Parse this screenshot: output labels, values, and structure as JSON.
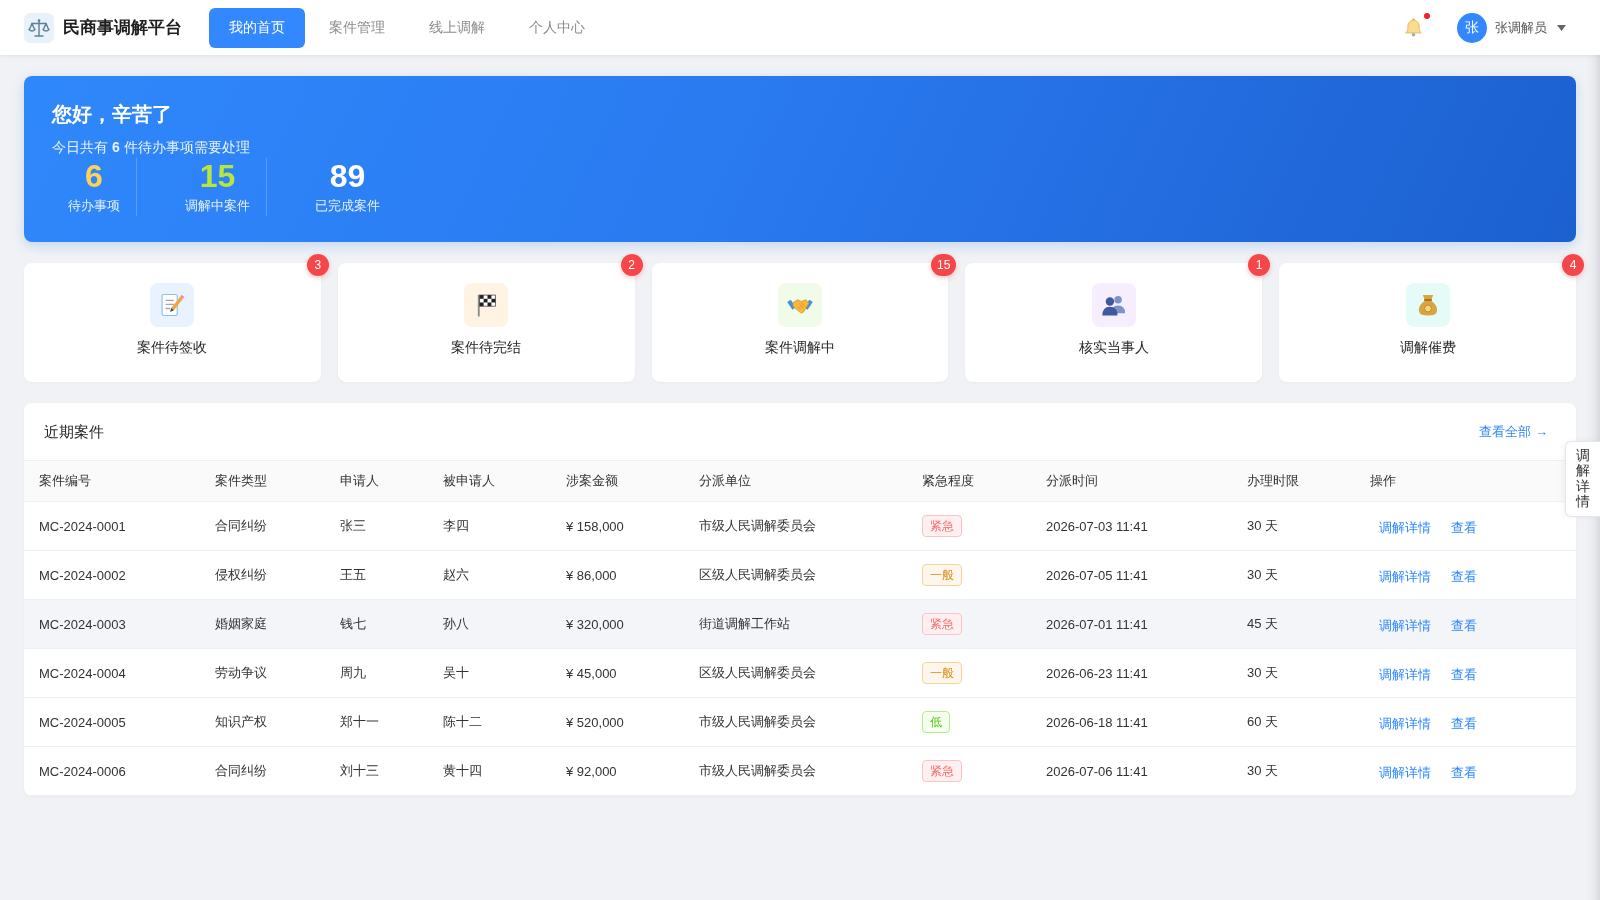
{
  "header": {
    "title": "民商事调解平台",
    "nav": [
      {
        "label": "我的首页",
        "selected": true
      },
      {
        "label": "案件管理",
        "selected": false
      },
      {
        "label": "线上调解",
        "selected": false
      },
      {
        "label": "个人中心",
        "selected": false
      }
    ],
    "notifications": {
      "unread": true
    },
    "user": {
      "avatar": "张",
      "name": "张调解员"
    }
  },
  "banner": {
    "greeting": "您好，辛苦了",
    "summary": "今日共有 **6** 件待办事项需要处理",
    "stats": [
      {
        "value": "6",
        "label": "待办事项",
        "color": "#fbd25a"
      },
      {
        "value": "15",
        "label": "调解中案件",
        "color": "#b9e63a"
      },
      {
        "value": "89",
        "label": "已完成案件",
        "color": "#ffffff"
      }
    ]
  },
  "shortcuts": [
    {
      "label": "案件待签收",
      "count": "3",
      "color": "#e8f3ff"
    },
    {
      "label": "案件待完结",
      "count": "2",
      "color": "#fff4e3"
    },
    {
      "label": "案件调解中",
      "count": "15",
      "color": "#f1fbe9"
    },
    {
      "label": "核实当事人",
      "count": "1",
      "color": "#f6edff"
    },
    {
      "label": "调解催费",
      "count": "4",
      "color": "#e5fbf8"
    }
  ],
  "recent_cases": {
    "title": "近期案件",
    "view_all": "查看全部 →",
    "columns": [
      "案件编号",
      "案件类型",
      "申请人",
      "被申请人",
      "涉案金额",
      "分派单位",
      "紧急程度",
      "分派时间",
      "办理时限",
      "操作"
    ],
    "rows": [
      {
        "case_no": "MC-2024-0001",
        "case_type": "合同纠纷",
        "applicant": "张三",
        "respondent": "李四",
        "amount": "¥ 158,000",
        "assigned_unit": "市级人民调解委员会",
        "urgency": {
          "text": "紧急",
          "kind": "high"
        },
        "assigned_at": "2026-07-03 11:41",
        "time_limit": "30 天",
        "actions": [
          "调解详情",
          "查看"
        ],
        "highlighted": false
      },
      {
        "case_no": "MC-2024-0002",
        "case_type": "侵权纠纷",
        "applicant": "王五",
        "respondent": "赵六",
        "amount": "¥ 86,000",
        "assigned_unit": "区级人民调解委员会",
        "urgency": {
          "text": "一般",
          "kind": "medium"
        },
        "assigned_at": "2026-07-05 11:41",
        "time_limit": "30 天",
        "actions": [
          "调解详情",
          "查看"
        ],
        "highlighted": false
      },
      {
        "case_no": "MC-2024-0003",
        "case_type": "婚姻家庭",
        "applicant": "钱七",
        "respondent": "孙八",
        "amount": "¥ 320,000",
        "assigned_unit": "街道调解工作站",
        "urgency": {
          "text": "紧急",
          "kind": "high"
        },
        "assigned_at": "2026-07-01 11:41",
        "time_limit": "45 天",
        "actions": [
          "调解详情",
          "查看"
        ],
        "highlighted": true
      },
      {
        "case_no": "MC-2024-0004",
        "case_type": "劳动争议",
        "applicant": "周九",
        "respondent": "吴十",
        "amount": "¥ 45,000",
        "assigned_unit": "区级人民调解委员会",
        "urgency": {
          "text": "一般",
          "kind": "medium"
        },
        "assigned_at": "2026-06-23 11:41",
        "time_limit": "30 天",
        "actions": [
          "调解详情",
          "查看"
        ],
        "highlighted": false
      },
      {
        "case_no": "MC-2024-0005",
        "case_type": "知识产权",
        "applicant": "郑十一",
        "respondent": "陈十二",
        "amount": "¥ 520,000",
        "assigned_unit": "市级人民调解委员会",
        "urgency": {
          "text": "低",
          "kind": "low"
        },
        "assigned_at": "2026-06-18 11:41",
        "time_limit": "60 天",
        "actions": [
          "调解详情",
          "查看"
        ],
        "highlighted": false
      },
      {
        "case_no": "MC-2024-0006",
        "case_type": "合同纠纷",
        "applicant": "刘十三",
        "respondent": "黄十四",
        "amount": "¥ 92,000",
        "assigned_unit": "市级人民调解委员会",
        "urgency": {
          "text": "紧急",
          "kind": "high"
        },
        "assigned_at": "2026-07-06 11:41",
        "time_limit": "30 天",
        "actions": [
          "调解详情",
          "查看"
        ],
        "highlighted": false
      }
    ]
  },
  "side_tab": {
    "label": "调解详情"
  }
}
